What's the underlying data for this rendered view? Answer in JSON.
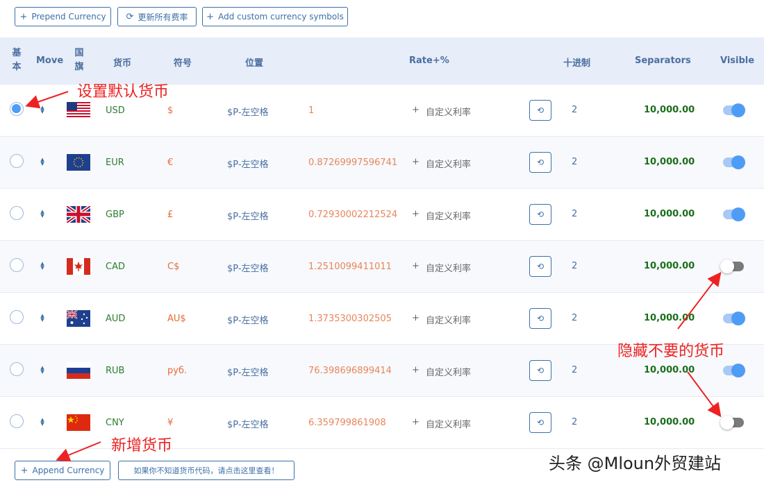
{
  "toolbar": {
    "prepend_label": "Prepend Currency",
    "update_rates_label": "更新所有费率",
    "add_symbols_label": "Add custom currency symbols"
  },
  "table": {
    "headers": {
      "basic_1": "基",
      "basic_2": "本",
      "move": "Move",
      "flag_1": "国",
      "flag_2": "旗",
      "currency": "货币",
      "symbol": "符号",
      "position": "位置",
      "rate": "Rate+%",
      "decimals": "十进制",
      "separators": "Separators",
      "visible": "Visible"
    },
    "rows": [
      {
        "code": "USD",
        "symbol": "$",
        "position": "$P-左空格",
        "rate": "1",
        "plus": "+",
        "custom_rate": "自定义利率",
        "decimals": "2",
        "separators": "10,000.00",
        "default": true,
        "visible": true,
        "flag": "us-flag"
      },
      {
        "code": "EUR",
        "symbol": "€",
        "position": "$P-左空格",
        "rate": "0.87269997596741",
        "plus": "+",
        "custom_rate": "自定义利率",
        "decimals": "2",
        "separators": "10,000.00",
        "default": false,
        "visible": true,
        "flag": "eu-flag"
      },
      {
        "code": "GBP",
        "symbol": "£",
        "position": "$P-左空格",
        "rate": "0.72930002212524",
        "plus": "+",
        "custom_rate": "自定义利率",
        "decimals": "2",
        "separators": "10,000.00",
        "default": false,
        "visible": true,
        "flag": "uk-flag"
      },
      {
        "code": "CAD",
        "symbol": "C$",
        "position": "$P-左空格",
        "rate": "1.2510099411011",
        "plus": "+",
        "custom_rate": "自定义利率",
        "decimals": "2",
        "separators": "10,000.00",
        "default": false,
        "visible": false,
        "flag": "ca-flag"
      },
      {
        "code": "AUD",
        "symbol": "AU$",
        "position": "$P-左空格",
        "rate": "1.3735300302505",
        "plus": "+",
        "custom_rate": "自定义利率",
        "decimals": "2",
        "separators": "10,000.00",
        "default": false,
        "visible": true,
        "flag": "au-flag"
      },
      {
        "code": "RUB",
        "symbol": "руб.",
        "position": "$P-左空格",
        "rate": "76.398696899414",
        "plus": "+",
        "custom_rate": "自定义利率",
        "decimals": "2",
        "separators": "10,000.00",
        "default": false,
        "visible": true,
        "flag": "ru-flag"
      },
      {
        "code": "CNY",
        "symbol": "¥",
        "position": "$P-左空格",
        "rate": "6.359799861908",
        "plus": "+",
        "custom_rate": "自定义利率",
        "decimals": "2",
        "separators": "10,000.00",
        "default": false,
        "visible": false,
        "flag": "cn-flag"
      }
    ]
  },
  "footer": {
    "append_label": "Append Currency",
    "help_link_label": "如果你不知道货币代码，请点击这里查看！"
  },
  "annotations": {
    "set_default": "设置默认货币",
    "hide_unwanted": "隐藏不要的货币",
    "add_currency": "新增货币"
  },
  "watermark": "头条 @Mloun外贸建站",
  "colors": {
    "accent": "#3b6fa8",
    "header_bg": "#e7edf9",
    "currency_code": "#2e7d32",
    "symbol": "#e86a3a",
    "rate": "#e8855a",
    "separators": "#1b6e1b",
    "toggle_on": "#4f9cf5",
    "annotation": "#ee2222"
  }
}
